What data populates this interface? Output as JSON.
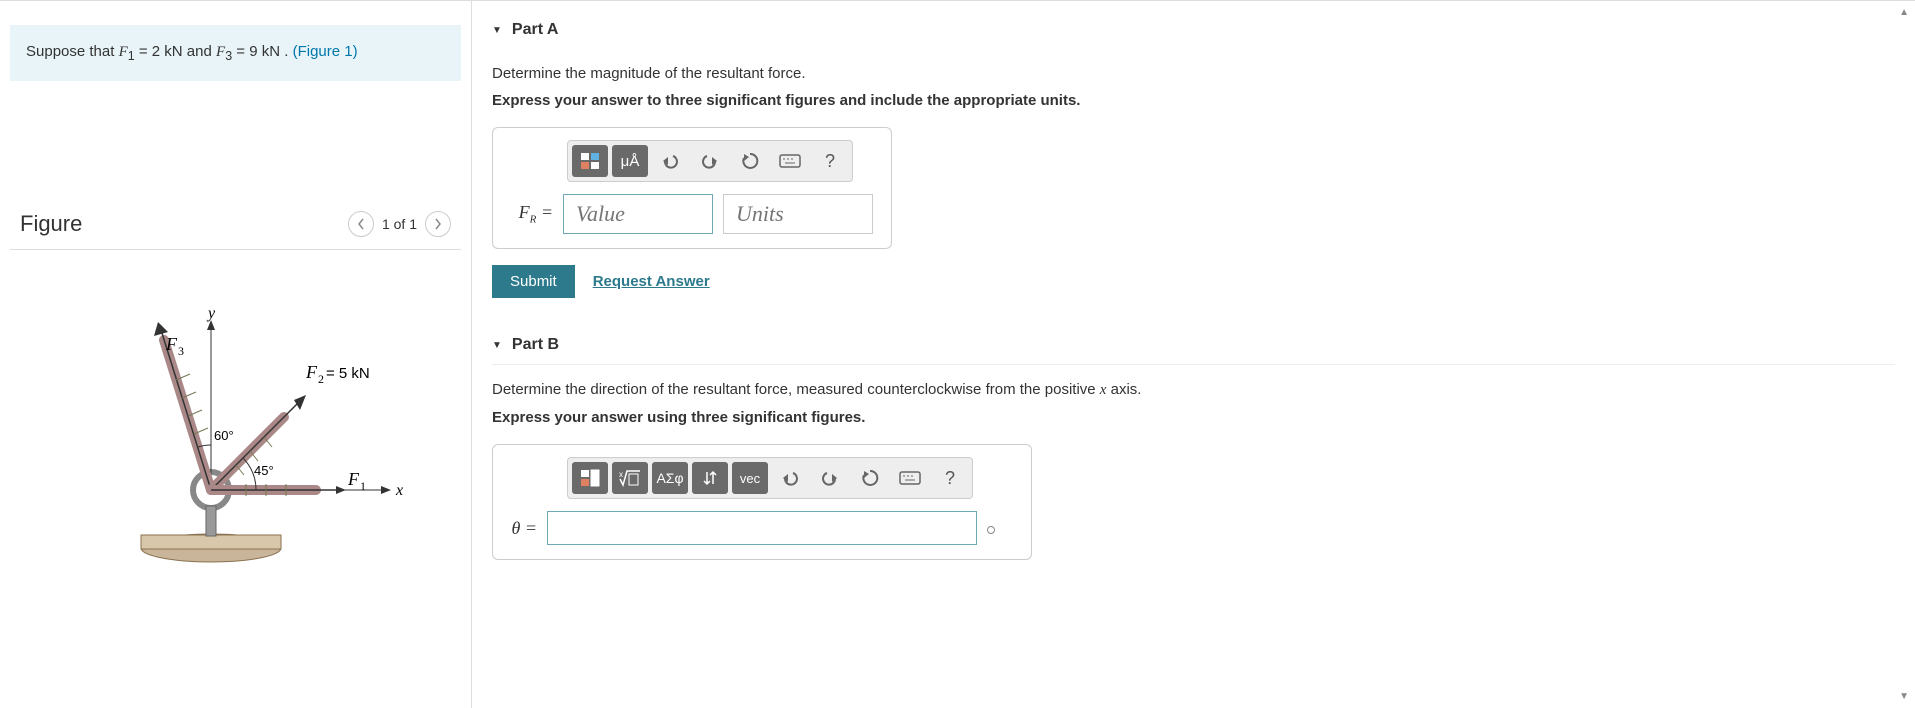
{
  "problem": {
    "prefix": "Suppose that ",
    "f1_var": "F",
    "f1_sub": "1",
    "f1_eq": " = 2  kN and ",
    "f3_var": "F",
    "f3_sub": "3",
    "f3_eq": " = 9  kN . ",
    "figure_link": "(Figure 1)"
  },
  "figure": {
    "title": "Figure",
    "nav_count": "1 of 1",
    "labels": {
      "y": "y",
      "x": "x",
      "F1": "F₁",
      "F2": "F₂ = 5 kN",
      "F3": "F₃",
      "angle60": "60°",
      "angle45": "45°"
    }
  },
  "partA": {
    "title": "Part A",
    "question": "Determine the magnitude of the resultant force.",
    "instruction": "Express your answer to three significant figures and include the appropriate units.",
    "var_label": "F",
    "var_sub": "R",
    "var_eq": " =",
    "value_placeholder": "Value",
    "units_placeholder": "Units",
    "toolbar": {
      "templates": "⬜",
      "units_btn": "μÅ",
      "undo": "↶",
      "redo": "↷",
      "reset": "↻",
      "keyboard": "⌨",
      "help": "?"
    },
    "submit": "Submit",
    "request": "Request Answer"
  },
  "partB": {
    "title": "Part B",
    "question_pre": "Determine the direction of the resultant force, measured counterclockwise from the positive ",
    "question_var": "x",
    "question_post": " axis.",
    "instruction": "Express your answer using three significant figures.",
    "var_label": "θ =",
    "toolbar": {
      "templates": "⬜",
      "sqrt": "√",
      "greek": "ΑΣφ",
      "updown": "↓↑",
      "vec": "vec",
      "undo": "↶",
      "redo": "↷",
      "reset": "↻",
      "keyboard": "⌨",
      "help": "?"
    }
  }
}
